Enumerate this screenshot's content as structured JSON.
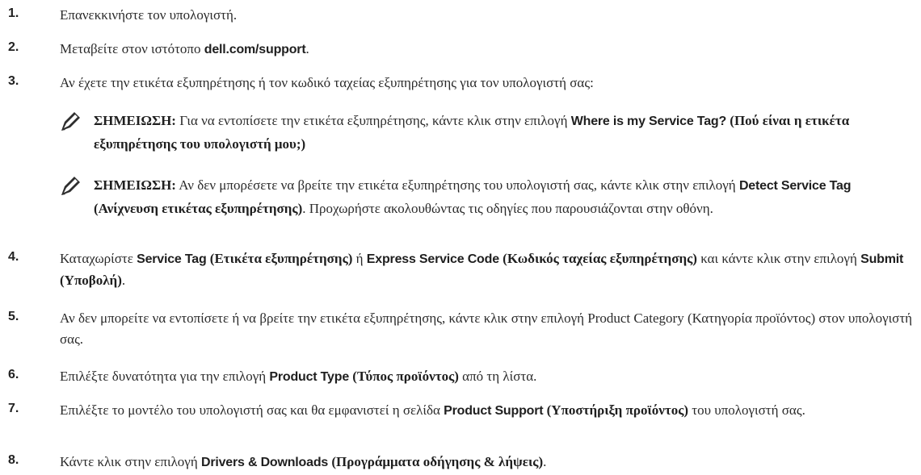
{
  "steps": [
    {
      "num": "1.",
      "parts": [
        {
          "t": "Επανεκκινήστε τον υπολογιστή."
        }
      ]
    },
    {
      "num": "2.",
      "parts": [
        {
          "t": "Μεταβείτε στον ιστότοπο "
        },
        {
          "t": "dell.com/support",
          "s": 1
        },
        {
          "t": "."
        }
      ]
    },
    {
      "num": "3.",
      "parts": [
        {
          "t": "Αν έχετε την ετικέτα εξυπηρέτησης ή τον κωδικό ταχείας εξυπηρέτησης για τον υπολογιστή σας:"
        }
      ]
    },
    {
      "num": "4.",
      "parts": [
        {
          "t": "Καταχωρίστε "
        },
        {
          "t": "Service Tag",
          "s": 1
        },
        {
          "t": " (Ετικέτα εξυπηρέτησης)",
          "g": 1
        },
        {
          "t": " ή "
        },
        {
          "t": "Express Service Code",
          "s": 1
        },
        {
          "t": " (Κωδικός ταχείας εξυπηρέτησης)",
          "g": 1
        },
        {
          "t": " και κάντε κλικ στην επιλογή "
        },
        {
          "t": "Submit",
          "s": 1
        },
        {
          "t": " (Υποβολή)",
          "g": 1
        },
        {
          "t": "."
        }
      ]
    },
    {
      "num": "5.",
      "parts": [
        {
          "t": "Αν δεν μπορείτε να εντοπίσετε ή να βρείτε την ετικέτα εξυπηρέτησης, κάντε κλικ στην επιλογή Product Category (Κατηγορία προϊόντος) στον υπολογιστή σας."
        }
      ]
    },
    {
      "num": "6.",
      "parts": [
        {
          "t": "Επιλέξτε δυνατότητα για την επιλογή "
        },
        {
          "t": "Product Type",
          "s": 1
        },
        {
          "t": " (Τύπος προϊόντος)",
          "g": 1
        },
        {
          "t": " από τη λίστα."
        }
      ]
    },
    {
      "num": "7.",
      "parts": [
        {
          "t": "Επιλέξτε το μοντέλο του υπολογιστή σας και θα εμφανιστεί η σελίδα "
        },
        {
          "t": "Product Support",
          "s": 1
        },
        {
          "t": " (Υποστήριξη προϊόντος)",
          "g": 1
        },
        {
          "t": " του υπολογιστή σας."
        }
      ]
    },
    {
      "num": "8.",
      "parts": [
        {
          "t": "Κάντε κλικ στην επιλογή "
        },
        {
          "t": "Drivers & Downloads",
          "s": 1
        },
        {
          "t": " (Προγράμματα οδήγησης & λήψεις)",
          "g": 1
        },
        {
          "t": "."
        }
      ]
    }
  ],
  "notes": [
    {
      "label": "ΣΗΜΕΙΩΣΗ:",
      "parts": [
        {
          "t": " Για να εντοπίσετε την ετικέτα εξυπηρέτησης, κάντε κλικ στην επιλογή "
        },
        {
          "t": "Where is my Service Tag?",
          "s": 1
        },
        {
          "t": " (Πού είναι η ετικέτα εξυπηρέτησης του υπολογιστή μου;)",
          "g": 1
        }
      ]
    },
    {
      "label": "ΣΗΜΕΙΩΣΗ:",
      "parts": [
        {
          "t": " Αν δεν μπορέσετε να βρείτε την ετικέτα εξυπηρέτησης του υπολογιστή σας, κάντε κλικ στην επιλογή "
        },
        {
          "t": "Detect Service Tag",
          "s": 1
        },
        {
          "t": " (Ανίχνευση ετικέτας εξυπηρέτησης)",
          "g": 1
        },
        {
          "t": ". Προχωρήστε ακολουθώντας τις οδηγίες που παρουσιάζονται στην οθόνη."
        }
      ]
    }
  ],
  "icons": {
    "note": "note-pencil-icon"
  }
}
